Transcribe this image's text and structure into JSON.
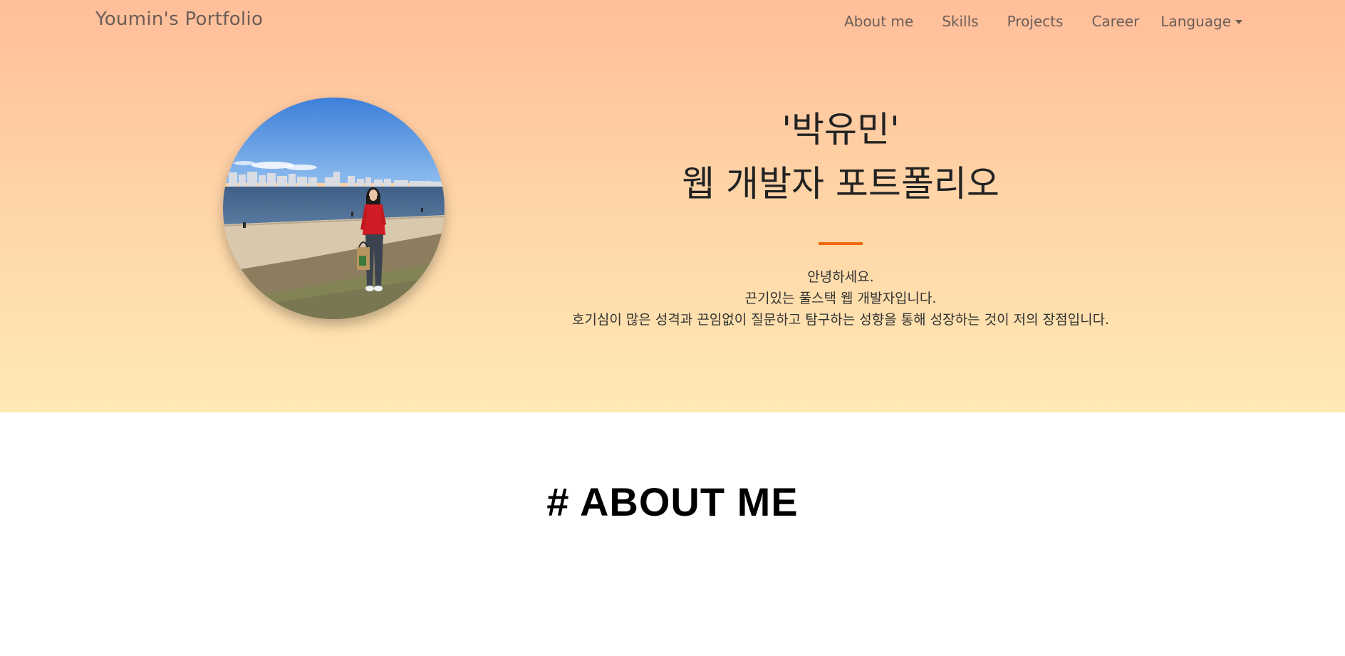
{
  "navbar": {
    "brand": "Youmin's Portfolio",
    "links": [
      "About me",
      "Skills",
      "Projects",
      "Career"
    ],
    "language_label": "Language",
    "language_icon": "caret-down-icon"
  },
  "hero": {
    "name": "'박유민'",
    "subtitle": "웹 개발자 포트폴리오",
    "divider_color": "#f06a0f",
    "intro": [
      "안녕하세요.",
      "끈기있는 풀스택 웹 개발자입니다.",
      "호기심이 많은 성격과 끈임없이 질문하고 탐구하는 성향을 통해 성장하는 것이 저의 장점입니다."
    ],
    "gradient": [
      "#ffbe9a",
      "#ffe9b4"
    ]
  },
  "about": {
    "title": "# ABOUT ME"
  }
}
